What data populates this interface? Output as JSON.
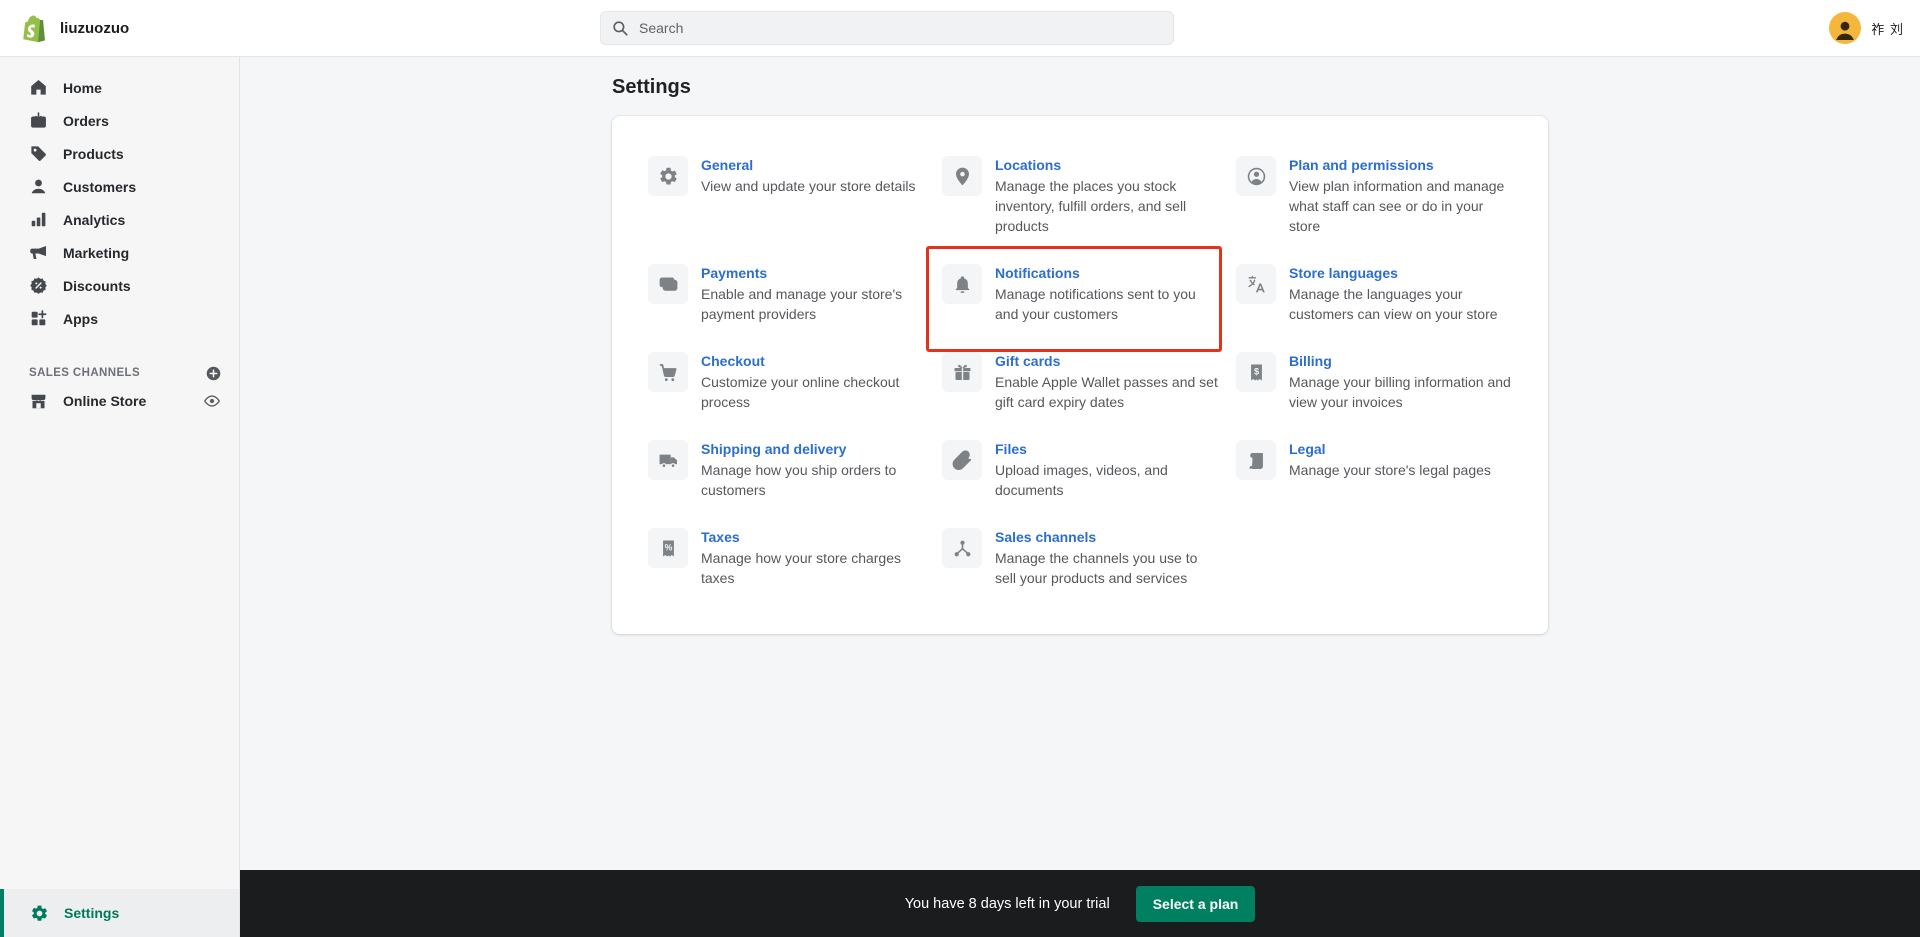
{
  "topbar": {
    "store_name": "liuzuozuo",
    "search_placeholder": "Search",
    "user_name": "祚 刘"
  },
  "sidebar": {
    "items": [
      {
        "label": "Home",
        "icon": "home"
      },
      {
        "label": "Orders",
        "icon": "orders"
      },
      {
        "label": "Products",
        "icon": "products"
      },
      {
        "label": "Customers",
        "icon": "customers"
      },
      {
        "label": "Analytics",
        "icon": "analytics"
      },
      {
        "label": "Marketing",
        "icon": "marketing"
      },
      {
        "label": "Discounts",
        "icon": "discounts"
      },
      {
        "label": "Apps",
        "icon": "apps"
      }
    ],
    "sales_channels_label": "SALES CHANNELS",
    "channels": [
      {
        "label": "Online Store",
        "icon": "storefront"
      }
    ],
    "settings_label": "Settings"
  },
  "main": {
    "title": "Settings",
    "cards": [
      {
        "title": "General",
        "desc": "View and update your store details",
        "icon": "gear",
        "highlighted": false
      },
      {
        "title": "Locations",
        "desc": "Manage the places you stock inventory, fulfill orders, and sell products",
        "icon": "location",
        "highlighted": false
      },
      {
        "title": "Plan and permissions",
        "desc": "View plan information and manage what staff can see or do in your store",
        "icon": "person-circle",
        "highlighted": false
      },
      {
        "title": "Payments",
        "desc": "Enable and manage your store's payment providers",
        "icon": "payments",
        "highlighted": false
      },
      {
        "title": "Notifications",
        "desc": "Manage notifications sent to you and your customers",
        "icon": "bell",
        "highlighted": true
      },
      {
        "title": "Store languages",
        "desc": "Manage the languages your customers can view on your store",
        "icon": "translate",
        "highlighted": false
      },
      {
        "title": "Checkout",
        "desc": "Customize your online checkout process",
        "icon": "cart",
        "highlighted": false
      },
      {
        "title": "Gift cards",
        "desc": "Enable Apple Wallet passes and set gift card expiry dates",
        "icon": "gift",
        "highlighted": false
      },
      {
        "title": "Billing",
        "desc": "Manage your billing information and view your invoices",
        "icon": "billing",
        "highlighted": false
      },
      {
        "title": "Shipping and delivery",
        "desc": "Manage how you ship orders to customers",
        "icon": "truck",
        "highlighted": false
      },
      {
        "title": "Files",
        "desc": "Upload images, videos, and documents",
        "icon": "paperclip",
        "highlighted": false
      },
      {
        "title": "Legal",
        "desc": "Manage your store's legal pages",
        "icon": "legal",
        "highlighted": false
      },
      {
        "title": "Taxes",
        "desc": "Manage how your store charges taxes",
        "icon": "taxes",
        "highlighted": false
      },
      {
        "title": "Sales channels",
        "desc": "Manage the channels you use to sell your products and services",
        "icon": "channels",
        "highlighted": false
      }
    ]
  },
  "footer": {
    "trial_text": "You have 8 days left in your trial",
    "button_label": "Select a plan"
  },
  "colors": {
    "brand_green": "#008060",
    "logo_green": "#95bf47",
    "link_blue": "#2c6ecb",
    "highlight_red": "#e0341c",
    "avatar_bg": "#f5b63c",
    "footer_bg": "#1a1c1d",
    "sidebar_bg": "#f6f6f7",
    "page_bg": "#f4f6f8"
  }
}
